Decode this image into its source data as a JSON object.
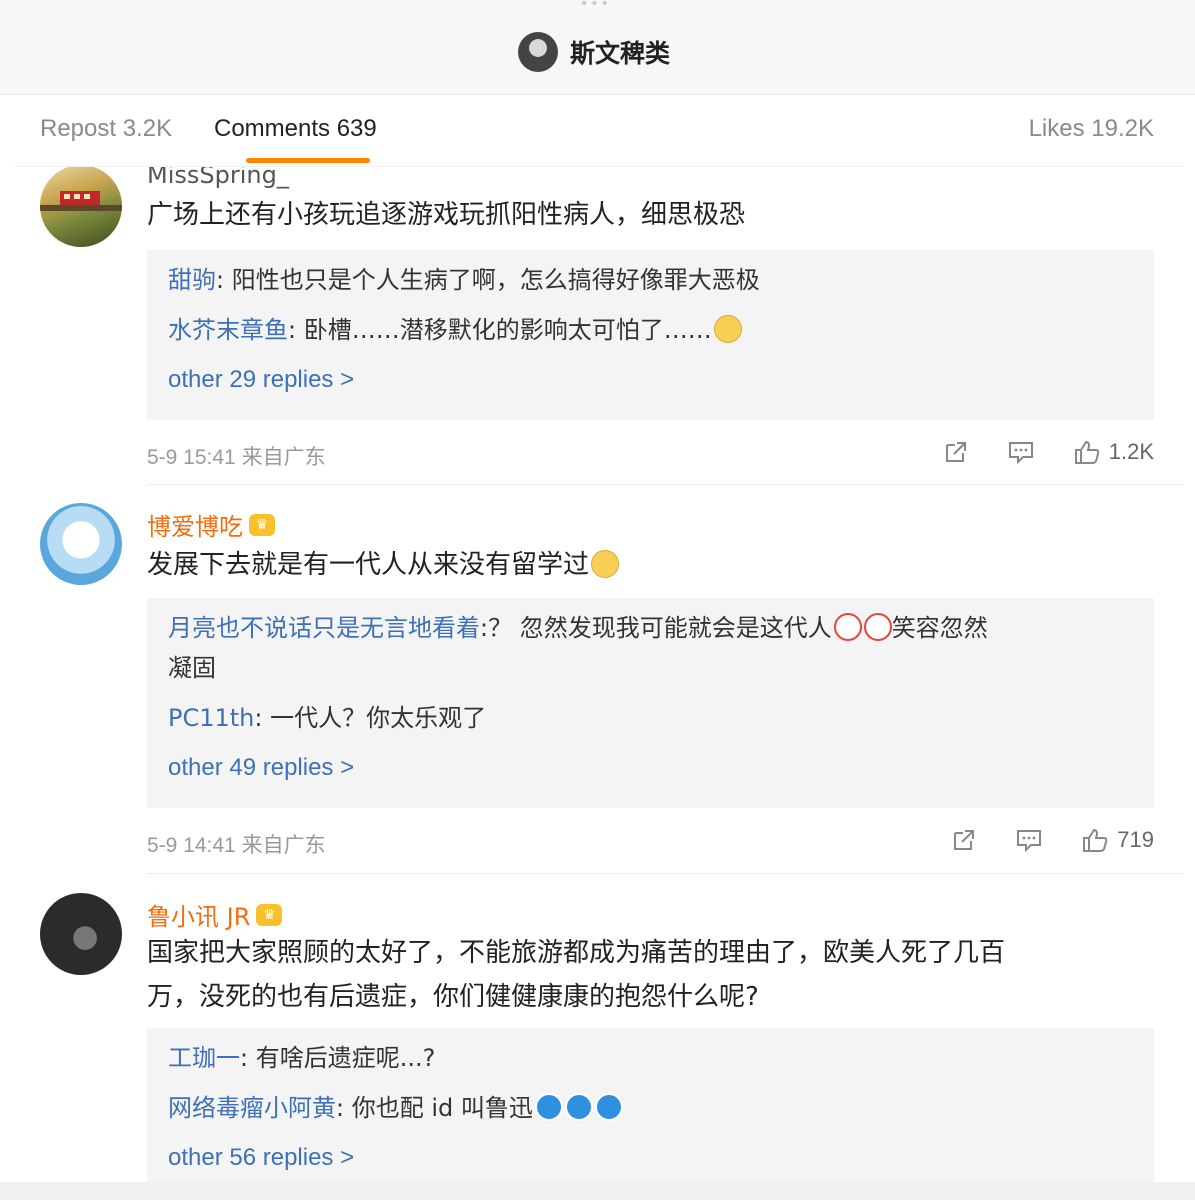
{
  "header": {
    "author_name": "斯文稗类",
    "dots": "•••"
  },
  "tabs": {
    "repost": "Repost 3.2K",
    "comments": "Comments 639",
    "likes": "Likes 19.2K"
  },
  "comments": [
    {
      "name": "MissSpring_",
      "text": "广场上还有小孩玩追逐游戏玩抓阳性病人，细思极恐",
      "replies": [
        {
          "name": "甜驹",
          "text": ": 阳性也只是个人生病了啊，怎么搞得好像罪大恶极"
        },
        {
          "name": "水芥末章鱼",
          "text": ": 卧槽……潜移默化的影响太可怕了……"
        }
      ],
      "more": "other 29 replies >",
      "time": "5-9 15:41 来自广东",
      "likes": "1.2K"
    },
    {
      "name": "博爱博吃",
      "text": "发展下去就是有一代人从来没有留学过",
      "replies": [
        {
          "name": "月亮也不说话只是无言地看着",
          "text": ":？ 忽然发现我可能就会是这代人",
          "text2": "笑容忽然",
          "line2": "凝固"
        },
        {
          "name": "PC11th",
          "text": ": 一代人？你太乐观了"
        }
      ],
      "more": "other 49 replies >",
      "time": "5-9 14:41 来自广东",
      "likes": "719"
    },
    {
      "name": "鲁小讯 JR",
      "text_line1": "国家把大家照顾的太好了，不能旅游都成为痛苦的理由了，欧美人死了几百",
      "text_line2": "万，没死的也有后遗症，你们健健康康的抱怨什么呢?",
      "replies": [
        {
          "name": "工珈一",
          "text": ": 有啥后遗症呢...?"
        },
        {
          "name": "网络毒瘤小阿黄",
          "text": ": 你也配 id 叫鲁迅"
        }
      ],
      "more": "other 56 replies >"
    }
  ],
  "colors": {
    "accent": "#ff8200",
    "link": "#3e70b8",
    "vip_name": "#f26d0e"
  },
  "icons": [
    "repost-icon",
    "comment-icon",
    "like-icon",
    "crown-icon"
  ]
}
